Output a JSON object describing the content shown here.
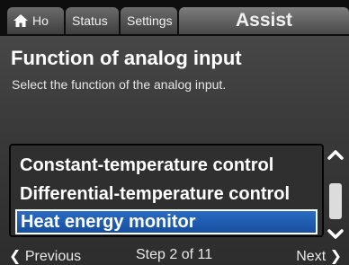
{
  "tabs": {
    "home_label": "Ho",
    "status_label": "Status",
    "settings_label": "Settings",
    "assist_label": "Assist"
  },
  "content": {
    "title": "Function of analog input",
    "description": "Select the function of the analog input."
  },
  "options": [
    {
      "label": "Constant-temperature control",
      "selected": false
    },
    {
      "label": "Differential-temperature control",
      "selected": false
    },
    {
      "label": "Heat energy monitor",
      "selected": true
    }
  ],
  "footer": {
    "previous_label": "Previous",
    "step_label": "Step 2 of 11",
    "next_label": "Next"
  },
  "icons": {
    "home": "home-icon",
    "previous": "chevron-left-icon",
    "next": "chevron-right-icon",
    "scroll_up": "chevron-up-icon",
    "scroll_down": "chevron-down-icon"
  },
  "colors": {
    "selection": "#1f5fb5",
    "selection_border": "#ffffff",
    "panel": "#3a3a3a"
  }
}
